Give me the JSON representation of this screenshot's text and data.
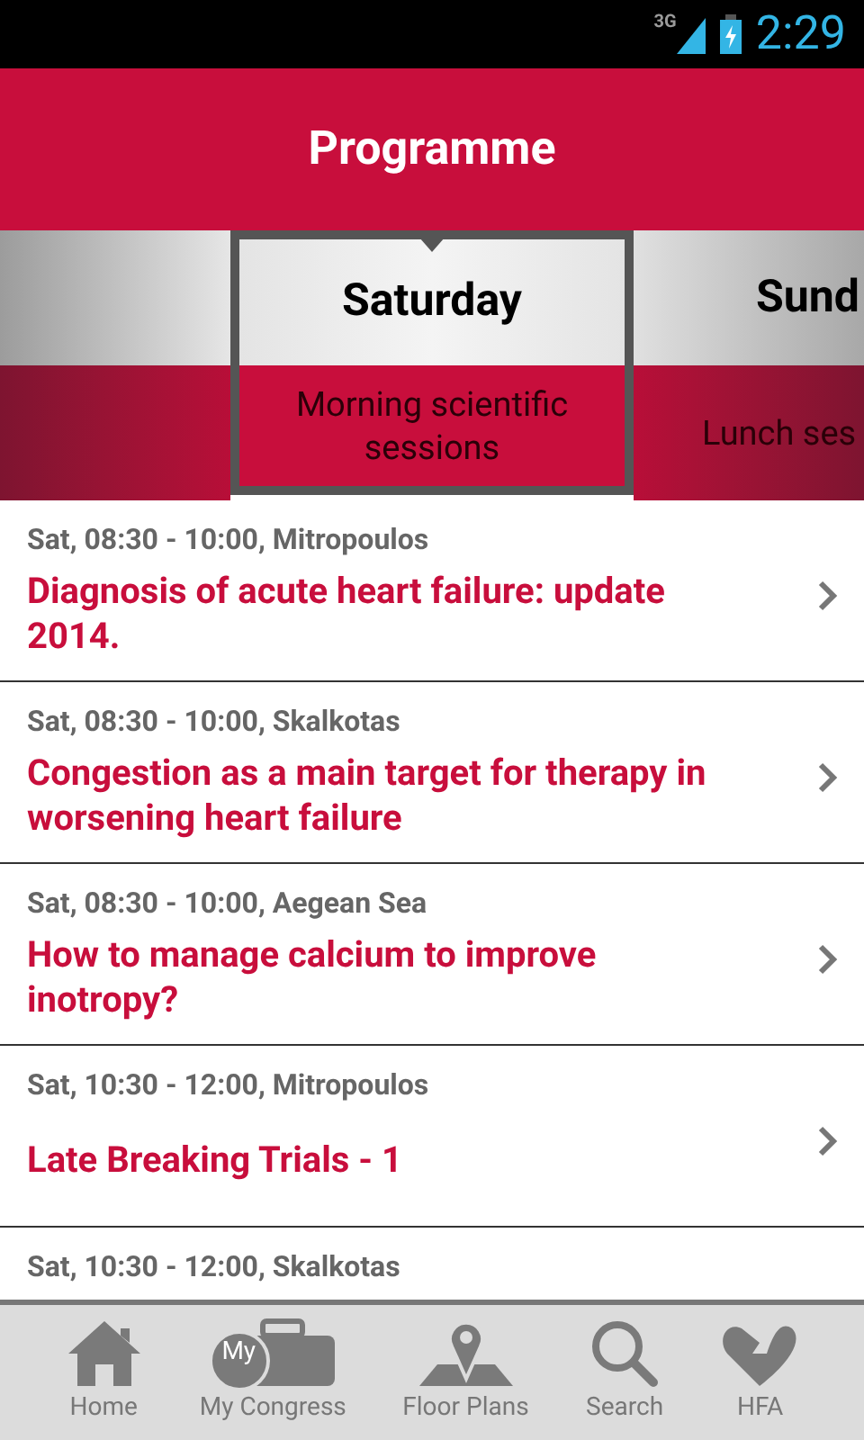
{
  "status_bar": {
    "network": "3G",
    "time": "2:29"
  },
  "header": {
    "title": "Programme"
  },
  "days": [
    {
      "label": "Saturday",
      "session": "Morning scientific\nsessions",
      "selected": true
    },
    {
      "label": "Sund",
      "session": "Lunch ses",
      "selected": false
    }
  ],
  "sessions": [
    {
      "meta": "Sat, 08:30 - 10:00, Mitropoulos",
      "title": "Diagnosis of acute heart failure: update 2014."
    },
    {
      "meta": "Sat, 08:30 - 10:00, Skalkotas",
      "title": "Congestion as a main target for therapy in worsening heart failure"
    },
    {
      "meta": "Sat, 08:30 - 10:00, Aegean Sea",
      "title": "How to manage calcium to improve inotropy?"
    },
    {
      "meta": "Sat, 10:30 - 12:00, Mitropoulos",
      "title": "Late Breaking Trials - 1"
    },
    {
      "meta": "Sat, 10:30 - 12:00, Skalkotas"
    }
  ],
  "tab_bar": [
    {
      "kind": "home",
      "label": "Home"
    },
    {
      "kind": "briefcase",
      "label": "My Congress",
      "badge": "My"
    },
    {
      "kind": "map",
      "label": "Floor Plans"
    },
    {
      "kind": "search",
      "label": "Search"
    },
    {
      "kind": "heart",
      "label": "HFA"
    }
  ]
}
